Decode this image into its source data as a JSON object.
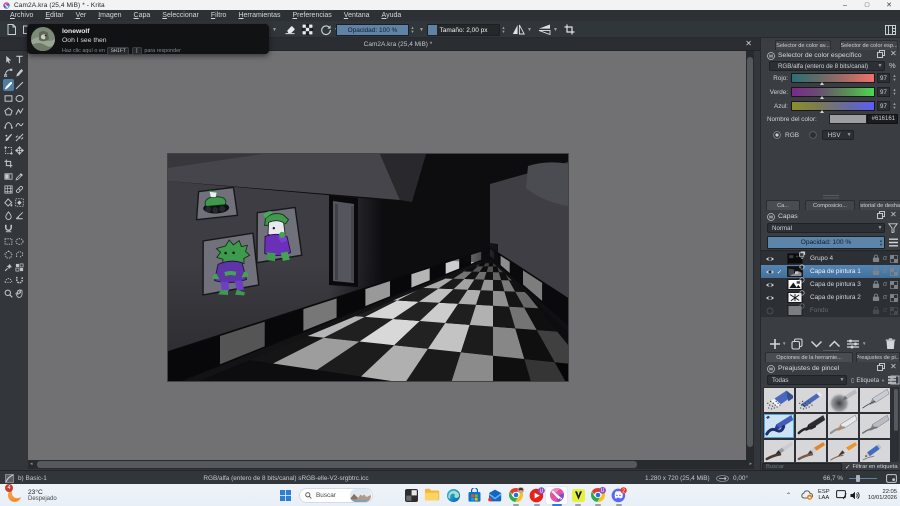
{
  "window": {
    "title": "Cam2A.kra (25,4 MiB) * - Krita",
    "minimize": "–",
    "maximize": "▢",
    "close": "✕"
  },
  "menu": {
    "items": [
      "Archivo",
      "Editar",
      "Ver",
      "Imagen",
      "Capa",
      "Seleccionar",
      "Filtro",
      "Herramientas",
      "Preferencias",
      "Ventana",
      "Ayuda"
    ]
  },
  "toolbar": {
    "opacity_label": "Opacidad: 100 %",
    "size_label": "Tamaño: 2,00 px"
  },
  "notification": {
    "username": "lonewolf",
    "message": "Ooh I see then",
    "footer_pre": "Haz clic aquí o en",
    "key_shift": "SHIFT",
    "key_pipe": "|",
    "footer_post": "para responder"
  },
  "document": {
    "tab_title": "Cam2A.kra (25,4 MiB) *"
  },
  "color_docker": {
    "tab_advanced": "Selector de color av...",
    "tab_specific": "Selector de color esp...",
    "title": "Selector de color específico",
    "model": "RGB/alfa (entero de 8 bits/canal)",
    "percent": "%",
    "channels": [
      {
        "label": "Rojo:",
        "value": "97"
      },
      {
        "label": "Verde:",
        "value": "97"
      },
      {
        "label": "Azul:",
        "value": "97"
      }
    ],
    "color_name_label": "Nombre del color:",
    "color_hex": "#616161",
    "radio_rgb": "RGB",
    "hsv_label": "HSV"
  },
  "layers_docker": {
    "tab_layers": "Ca...",
    "tab_compositions": "Composicio...",
    "tab_undo_history": "Historial de desha...",
    "title": "Capas",
    "blend_mode": "Normal",
    "opacity_label": "Opacidad:  100 %",
    "layers": [
      {
        "name": "Grupo 4"
      },
      {
        "name": "Capa de pintura 1"
      },
      {
        "name": "Capa de pintura 3"
      },
      {
        "name": "Capa de pintura 2"
      },
      {
        "name": "Fondo"
      }
    ],
    "alpha_label": "α"
  },
  "brush_docker": {
    "tab_tool_options": "Opciones de la herramie...",
    "tab_presets": "Preajustes de pi...",
    "title": "Preajustes de pincel",
    "filter_all": "Todas",
    "tag_label": "Etiqueta",
    "search_placeholder": "Buscar",
    "filter_checkbox": "Filtrar en etiqueta"
  },
  "statusbar": {
    "preset": "b) Basic-1",
    "profile": "RGB/alfa (entero de 8 bits/canal)  sRGB-elle-V2-srgbtrc.icc",
    "image_size": "1.280 x 720 (25,4 MiB)",
    "rotation": "0,00°",
    "zoom": "66,7 %"
  },
  "taskbar": {
    "weather_badge": "4",
    "weather_temp": "23°C",
    "weather_desc": "Despejado",
    "search_placeholder": "Buscar",
    "youtube_badge": "U",
    "chrome2_badge": "U",
    "discord_badge": "2",
    "tray_lang_top": "ESP",
    "tray_lang_bottom": "LAA",
    "time": "22:05",
    "date": "10/01/2026"
  }
}
